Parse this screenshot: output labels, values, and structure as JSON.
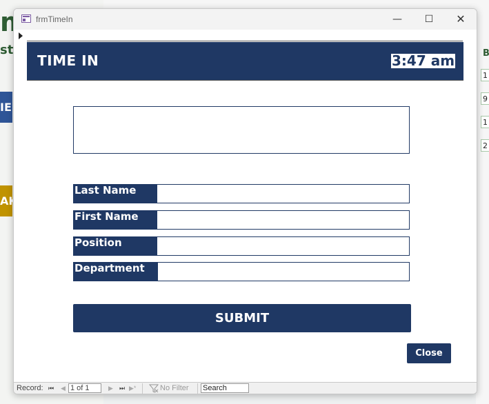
{
  "background": {
    "left_title_fragment": "m",
    "left_subtitle_fragment": "st",
    "left_button1_fragment": "IE",
    "left_button2_fragment": "AK",
    "right_header_fragment": "B",
    "right_cells": [
      "1",
      "9",
      "1",
      "2"
    ]
  },
  "window": {
    "title": "frmTimeIn",
    "minimize_icon": "minimize-icon",
    "maximize_icon": "maximize-icon",
    "close_icon": "close-icon"
  },
  "form": {
    "header_title": "TIME IN",
    "clock": "3:47 am",
    "fields": [
      {
        "label": "Last Name",
        "value": ""
      },
      {
        "label": "First Name",
        "value": ""
      },
      {
        "label": "Position",
        "value": ""
      },
      {
        "label": "Department",
        "value": ""
      }
    ],
    "submit_label": "SUBMIT",
    "close_label": "Close"
  },
  "navigation": {
    "record_label": "Record:",
    "current_record": "1 of 1",
    "filter_status": "No Filter",
    "search_placeholder": "Search"
  },
  "colors": {
    "accent": "#1f3864",
    "accent_text": "#ffffff"
  }
}
